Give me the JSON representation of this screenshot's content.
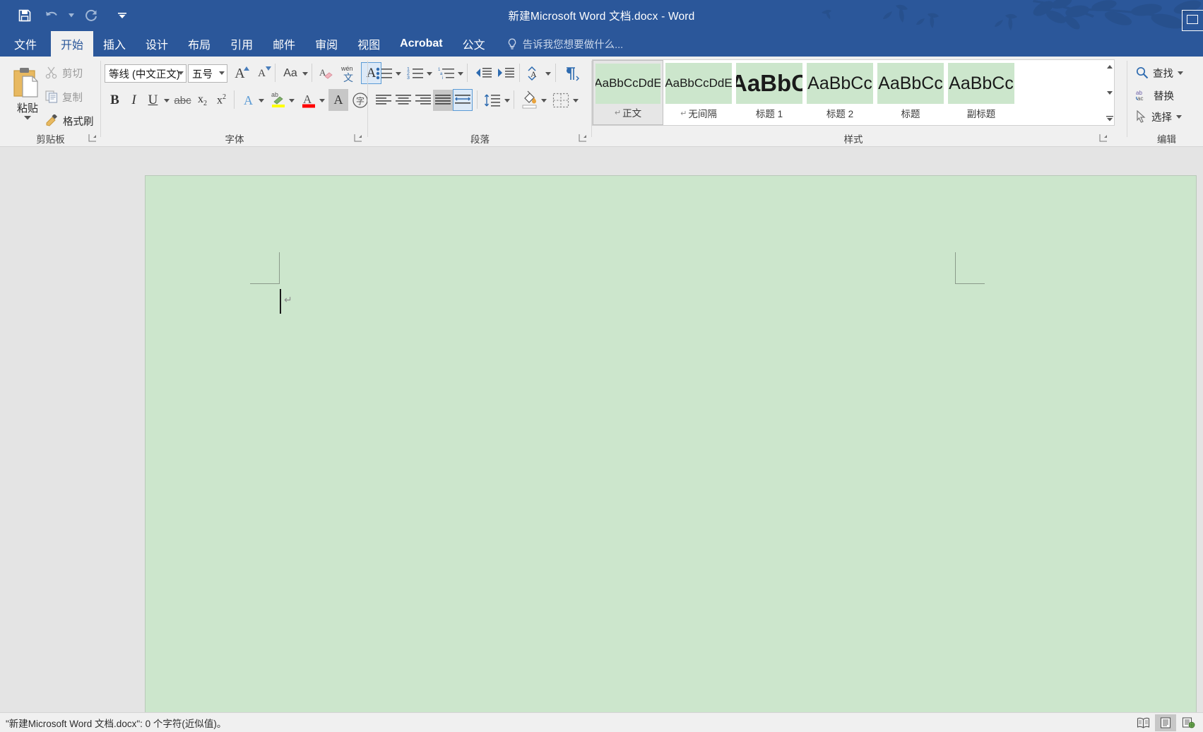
{
  "window": {
    "title": "新建Microsoft Word 文档.docx - Word",
    "accent_color": "#2b579a",
    "ribbon_bg": "#f0f0f0",
    "page_color": "#cce6cc",
    "minimize_label": ""
  },
  "quick_access": [
    {
      "name": "save-button",
      "icon": "save-icon",
      "label": "保存"
    },
    {
      "name": "undo-button",
      "icon": "undo-icon",
      "label": "撤消"
    },
    {
      "name": "redo-button",
      "icon": "redo-icon",
      "label": "恢复"
    },
    {
      "name": "customize-qat-button",
      "icon": "chevron-down-icon",
      "label": "自定义快速访问工具栏"
    }
  ],
  "tabs": [
    {
      "label": "文件",
      "active": false
    },
    {
      "label": "开始",
      "active": true
    },
    {
      "label": "插入",
      "active": false
    },
    {
      "label": "设计",
      "active": false
    },
    {
      "label": "布局",
      "active": false
    },
    {
      "label": "引用",
      "active": false
    },
    {
      "label": "邮件",
      "active": false
    },
    {
      "label": "审阅",
      "active": false
    },
    {
      "label": "视图",
      "active": false
    },
    {
      "label": "Acrobat",
      "active": false
    },
    {
      "label": "公文",
      "active": false
    }
  ],
  "tell_me": {
    "placeholder": "告诉我您想要做什么...",
    "icon": "lightbulb-icon"
  },
  "ribbon": {
    "clipboard": {
      "group_label": "剪贴板",
      "paste": {
        "label": "粘贴",
        "icon": "paste-icon"
      },
      "cut": {
        "label": "剪切",
        "icon": "scissors-icon",
        "enabled": false
      },
      "copy": {
        "label": "复制",
        "icon": "copy-icon",
        "enabled": false
      },
      "format_painter": {
        "label": "格式刷",
        "icon": "format-painter-icon",
        "enabled": true
      }
    },
    "font": {
      "group_label": "字体",
      "font_name": "等线 (中文正文)",
      "font_size": "五号",
      "buttons": [
        {
          "name": "grow-font-button",
          "label": "增大字号",
          "glyph": "A"
        },
        {
          "name": "shrink-font-button",
          "label": "减小字号",
          "glyph": "A"
        },
        {
          "name": "change-case-button",
          "label": "更改大小写",
          "glyph": "Aa"
        },
        {
          "name": "clear-formatting-button",
          "label": "清除所有格式",
          "glyph": "A"
        },
        {
          "name": "phonetic-guide-button",
          "label": "拼音指南",
          "glyph": "文"
        },
        {
          "name": "character-border-button",
          "label": "字符边框",
          "glyph": "A"
        },
        {
          "name": "bold-button",
          "label": "加粗",
          "glyph": "B"
        },
        {
          "name": "italic-button",
          "label": "倾斜",
          "glyph": "I"
        },
        {
          "name": "underline-button",
          "label": "下划线",
          "glyph": "U"
        },
        {
          "name": "strikethrough-button",
          "label": "删除线",
          "glyph": "abc"
        },
        {
          "name": "subscript-button",
          "label": "下标",
          "glyph": "x₂"
        },
        {
          "name": "superscript-button",
          "label": "上标",
          "glyph": "x²"
        },
        {
          "name": "text-effects-button",
          "label": "文本效果和版式",
          "glyph": "A"
        },
        {
          "name": "text-highlight-button",
          "label": "文本突出显示颜色",
          "glyph": "ab"
        },
        {
          "name": "font-color-button",
          "label": "字体颜色",
          "glyph": "A",
          "color": "#ff0000"
        },
        {
          "name": "character-shading-button",
          "label": "字符底纹",
          "glyph": "A"
        },
        {
          "name": "enclose-characters-button",
          "label": "带圈字符",
          "glyph": "字"
        }
      ]
    },
    "paragraph": {
      "group_label": "段落",
      "buttons": [
        {
          "name": "bullets-button",
          "label": "项目符号"
        },
        {
          "name": "numbering-button",
          "label": "编号"
        },
        {
          "name": "multilevel-list-button",
          "label": "多级列表"
        },
        {
          "name": "decrease-indent-button",
          "label": "减少缩进量"
        },
        {
          "name": "increase-indent-button",
          "label": "增加缩进量"
        },
        {
          "name": "sort-button",
          "label": "排序"
        },
        {
          "name": "show-marks-button",
          "label": "显示/隐藏编辑标记"
        },
        {
          "name": "align-left-button",
          "label": "左对齐"
        },
        {
          "name": "align-center-button",
          "label": "居中"
        },
        {
          "name": "align-right-button",
          "label": "右对齐"
        },
        {
          "name": "justify-button",
          "label": "两端对齐",
          "active": true
        },
        {
          "name": "distribute-button",
          "label": "分散对齐"
        },
        {
          "name": "line-spacing-button",
          "label": "行和段落间距"
        },
        {
          "name": "shading-button",
          "label": "底纹"
        },
        {
          "name": "borders-button",
          "label": "边框"
        }
      ]
    },
    "styles": {
      "group_label": "样式",
      "items": [
        {
          "preview": "AaBbCcDdE",
          "name": "正文",
          "pilcrow": true,
          "active": true,
          "size": 17
        },
        {
          "preview": "AaBbCcDdE",
          "name": "无间隔",
          "pilcrow": true,
          "active": false,
          "size": 17
        },
        {
          "preview": "AaBbC",
          "name": "标题 1",
          "pilcrow": false,
          "active": false,
          "size": 33
        },
        {
          "preview": "AaBbCc",
          "name": "标题 2",
          "pilcrow": false,
          "active": false,
          "size": 25
        },
        {
          "preview": "AaBbCc",
          "name": "标题",
          "pilcrow": false,
          "active": false,
          "size": 25
        },
        {
          "preview": "AaBbCc",
          "name": "副标题",
          "pilcrow": false,
          "active": false,
          "size": 25
        }
      ],
      "scroll_up": "上一行",
      "scroll_down": "下一行",
      "more": "其他"
    },
    "editing": {
      "group_label": "编辑",
      "find": {
        "label": "查找",
        "icon": "search-icon"
      },
      "replace": {
        "label": "替换",
        "icon": "replace-icon"
      },
      "select": {
        "label": "选择",
        "icon": "cursor-arrow-icon"
      }
    }
  },
  "document": {
    "content": "",
    "paragraph_mark": "↵"
  },
  "status": {
    "text": "\"新建Microsoft Word 文档.docx\": 0 个字符(近似值)。",
    "views": [
      {
        "name": "read-mode-button",
        "label": "阅读视图",
        "active": false
      },
      {
        "name": "print-layout-button",
        "label": "页面视图",
        "active": true
      },
      {
        "name": "web-layout-button",
        "label": "Web 版式视图",
        "active": false
      }
    ]
  }
}
